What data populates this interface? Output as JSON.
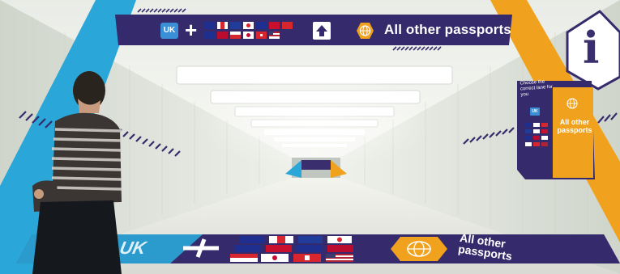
{
  "scene": {
    "description_colors": {
      "navy": "#352a6b",
      "blue_accent": "#2aa7d8",
      "orange_accent": "#f0a21e",
      "tunnel_light": "#f2f4f0",
      "tunnel_wall": "#dfe3da"
    }
  },
  "top_sign": {
    "uk_badge": "UK",
    "plus": "+",
    "arrow_icon": "arrow-up-icon",
    "globe_icon": "globe-icon",
    "other_label": "All other passports"
  },
  "side_sign": {
    "info_glyph": "i",
    "choose_text": "Choose the correct lane for you",
    "uk_badge": "UK",
    "other_label": "All other passports"
  },
  "floor_sign": {
    "uk_label": "UK",
    "plus": "+",
    "globe_icon": "globe-icon",
    "other_label": "All other passports"
  }
}
